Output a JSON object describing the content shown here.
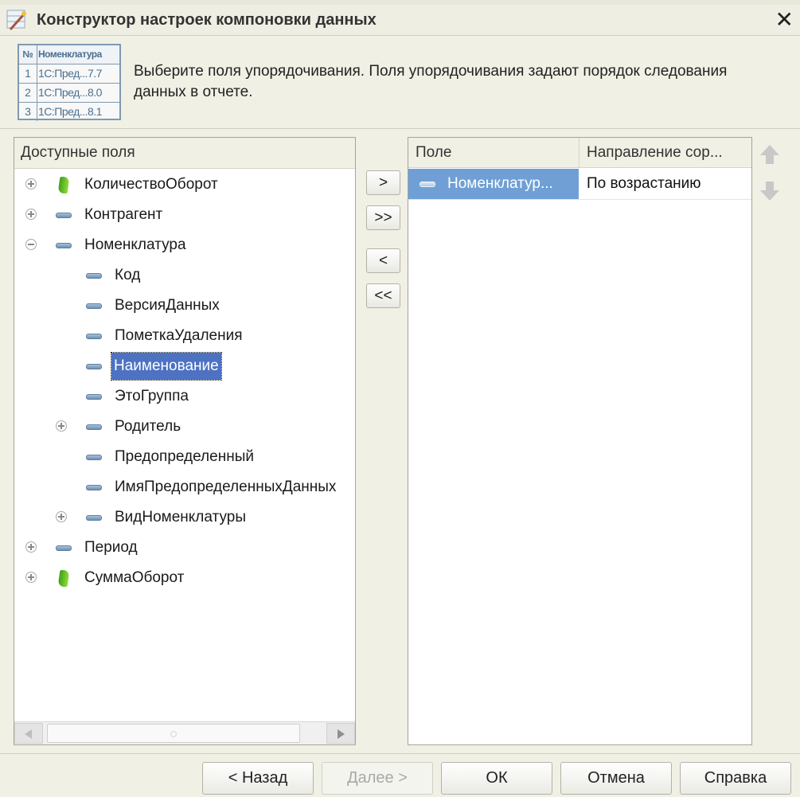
{
  "window": {
    "title": "Конструктор настроек компоновки данных",
    "close_icon": "close-icon"
  },
  "header": {
    "description": "Выберите поля упорядочивания. Поля упорядочивания задают порядок следования данных в отчете.",
    "illustration": {
      "col_num": "№",
      "col_name": "Номенклатура",
      "rows": [
        {
          "n": "1",
          "v": "1С:Пред...7.7"
        },
        {
          "n": "2",
          "v": "1С:Пред...8.0"
        },
        {
          "n": "3",
          "v": "1С:Пред...8.1"
        }
      ]
    }
  },
  "available_fields": {
    "header": "Доступные поля",
    "items": [
      {
        "label": "КоличествоОборот",
        "level": 0,
        "expander": "plus",
        "icon": "resource-icon"
      },
      {
        "label": "Контрагент",
        "level": 0,
        "expander": "plus",
        "icon": "field-icon"
      },
      {
        "label": "Номенклатура",
        "level": 0,
        "expander": "minus",
        "icon": "field-icon"
      },
      {
        "label": "Код",
        "level": 1,
        "expander": "none",
        "icon": "field-icon"
      },
      {
        "label": "ВерсияДанных",
        "level": 1,
        "expander": "none",
        "icon": "field-icon"
      },
      {
        "label": "ПометкаУдаления",
        "level": 1,
        "expander": "none",
        "icon": "field-icon"
      },
      {
        "label": "Наименование",
        "level": 1,
        "expander": "none",
        "icon": "field-icon",
        "selected": true
      },
      {
        "label": "ЭтоГруппа",
        "level": 1,
        "expander": "none",
        "icon": "field-icon"
      },
      {
        "label": "Родитель",
        "level": 1,
        "expander": "plus",
        "icon": "field-icon"
      },
      {
        "label": "Предопределенный",
        "level": 1,
        "expander": "none",
        "icon": "field-icon"
      },
      {
        "label": "ИмяПредопределенныхДанных",
        "level": 1,
        "expander": "none",
        "icon": "field-icon"
      },
      {
        "label": "ВидНоменклатуры",
        "level": 1,
        "expander": "plus",
        "icon": "field-icon"
      },
      {
        "label": "Период",
        "level": 0,
        "expander": "plus",
        "icon": "field-icon"
      },
      {
        "label": "СуммаОборот",
        "level": 0,
        "expander": "plus",
        "icon": "resource-icon"
      }
    ]
  },
  "transfer_buttons": {
    "add": ">",
    "add_all": ">>",
    "remove": "<",
    "remove_all": "<<"
  },
  "order": {
    "col_field": "Поле",
    "col_direction": "Направление сор...",
    "rows": [
      {
        "field": "Номенклатур...",
        "direction": "По возрастанию"
      }
    ],
    "move_up_icon": "arrow-up-icon",
    "move_down_icon": "arrow-down-icon"
  },
  "footer": {
    "back": "< Назад",
    "next": "Далее >",
    "ok": "ОК",
    "cancel": "Отмена",
    "help": "Справка"
  }
}
